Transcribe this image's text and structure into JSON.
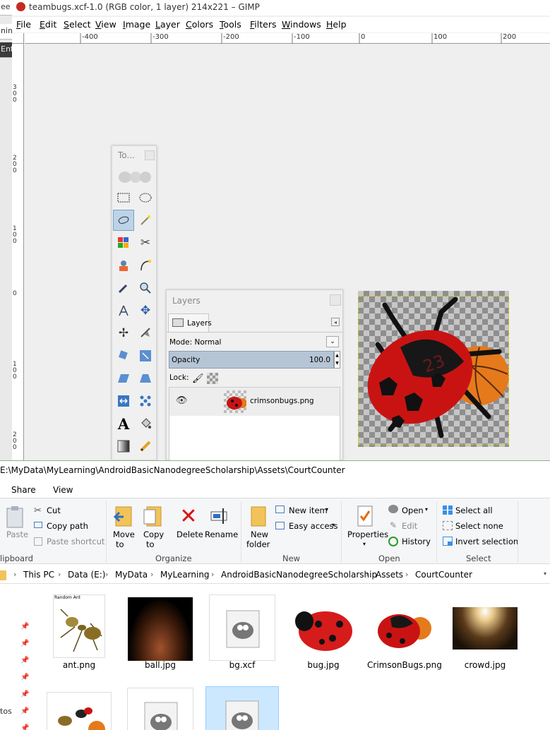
{
  "left_strip": {
    "chips": [
      "ee C",
      "nin",
      "Ent"
    ]
  },
  "gimp": {
    "title": "teambugs.xcf-1.0 (RGB color, 1 layer) 214x221 – GIMP",
    "menu": [
      {
        "label": "File",
        "u": "F",
        "rest": "ile"
      },
      {
        "label": "Edit",
        "u": "E",
        "rest": "dit"
      },
      {
        "label": "Select",
        "u": "S",
        "rest": "elect"
      },
      {
        "label": "View",
        "u": "V",
        "rest": "iew"
      },
      {
        "label": "Image",
        "u": "I",
        "rest": "mage"
      },
      {
        "label": "Layer",
        "u": "L",
        "rest": "ayer"
      },
      {
        "label": "Colors",
        "u": "C",
        "rest": "olors"
      },
      {
        "label": "Tools",
        "u": "T",
        "rest": "ools"
      },
      {
        "label": "Filters",
        "u": "F",
        "rest": "ilters"
      },
      {
        "label": "Windows",
        "u": "W",
        "rest": "indows"
      },
      {
        "label": "Help",
        "u": "H",
        "rest": "elp"
      }
    ],
    "ruler_top": [
      "-400",
      "-300",
      "-200",
      "-100",
      "0",
      "100",
      "200"
    ],
    "ruler_left": [
      "300",
      "200",
      "100",
      "0",
      "100",
      "200"
    ],
    "toolbox": {
      "title": "To...",
      "tools": [
        "rect-select-icon",
        "ellipse-select-icon",
        "free-select-icon",
        "fuzzy-select-icon",
        "select-by-color-icon",
        "scissors-icon",
        "foreground-select-icon",
        "paths-icon",
        "color-picker-icon",
        "zoom-icon",
        "measure-icon",
        "move-icon",
        "align-icon",
        "crop-icon",
        "rotate-icon",
        "scale-icon",
        "shear-icon",
        "perspective-icon",
        "flip-icon",
        "cage-icon",
        "text-icon",
        "bucket-fill-icon",
        "blend-icon",
        "pencil-icon"
      ]
    },
    "layers": {
      "title": "Layers",
      "tab": "Layers",
      "mode_label": "Mode: Normal",
      "opacity_label": "Opacity",
      "opacity_value": "100.0",
      "lock_label": "Lock:",
      "layer_name": "crimsonbugs.png"
    }
  },
  "explorer": {
    "path": "E:\\MyData\\MyLearning\\AndroidBasicNanodegreeScholarship\\Assets\\CourtCounter",
    "tabs": [
      "Share",
      "View"
    ],
    "clipboard": {
      "paste": "Paste",
      "cut": "Cut",
      "copy_path": "Copy path",
      "paste_shortcut": "Paste shortcut",
      "group": "lipboard"
    },
    "organize": {
      "move_to_1": "Move",
      "move_to_2": "to",
      "copy_to_1": "Copy",
      "copy_to_2": "to",
      "delete": "Delete",
      "rename": "Rename",
      "group": "Organize"
    },
    "new": {
      "new_folder_1": "New",
      "new_folder_2": "folder",
      "new_item": "New item",
      "easy_access": "Easy access",
      "group": "New"
    },
    "open": {
      "properties": "Properties",
      "open": "Open",
      "edit": "Edit",
      "history": "History",
      "group": "Open"
    },
    "select": {
      "select_all": "Select all",
      "select_none": "Select none",
      "invert_selection": "Invert selection",
      "group": "Select"
    },
    "breadcrumbs": [
      "This PC",
      "Data (E:)",
      "MyData",
      "MyLearning",
      "AndroidBasicNanodegreeScholarship",
      "Assets",
      "CourtCounter"
    ],
    "nav_side": [
      "tos"
    ],
    "files": [
      {
        "name": "ant.png",
        "caption": "Random Ant"
      },
      {
        "name": "ball.jpg"
      },
      {
        "name": "bg.xcf"
      },
      {
        "name": "bug.jpg"
      },
      {
        "name": "CrimsonBugs.png"
      },
      {
        "name": "crowd.jpg"
      }
    ]
  }
}
